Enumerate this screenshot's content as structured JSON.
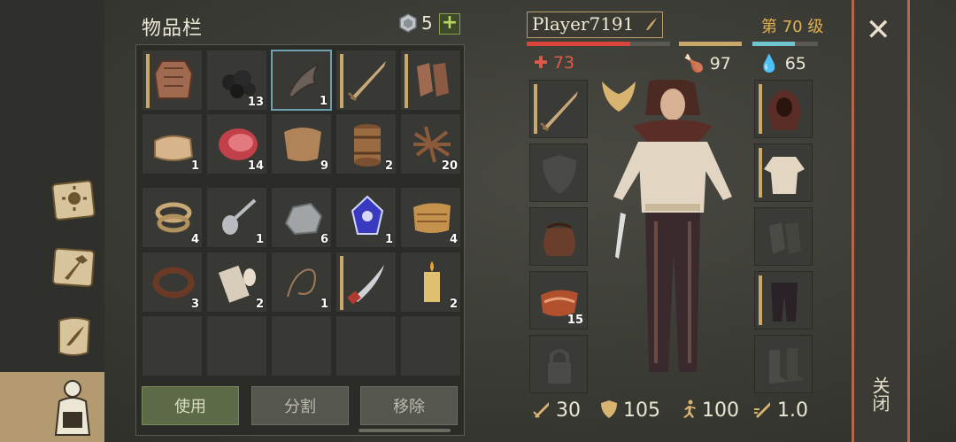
{
  "inventory": {
    "title": "物品栏",
    "currency_count": "5",
    "add_label": "+",
    "slots": [
      {
        "item": "gambeson",
        "count": ""
      },
      {
        "item": "coal",
        "count": "13"
      },
      {
        "item": "dark-bow",
        "count": "1",
        "selected": true
      },
      {
        "item": "sword",
        "count": ""
      },
      {
        "item": "gloves",
        "count": ""
      },
      {
        "item": "cloth",
        "count": "1"
      },
      {
        "item": "raw-meat",
        "count": "14"
      },
      {
        "item": "leather",
        "count": "9"
      },
      {
        "item": "barrel",
        "count": "2"
      },
      {
        "item": "sticks",
        "count": "20"
      },
      {
        "item": "rope",
        "count": "4"
      },
      {
        "item": "spoon",
        "count": "1"
      },
      {
        "item": "stone",
        "count": "6"
      },
      {
        "item": "crystal",
        "count": "1"
      },
      {
        "item": "straw",
        "count": "4"
      },
      {
        "item": "leather-strap",
        "count": "3"
      },
      {
        "item": "fabric-roll",
        "count": "2"
      },
      {
        "item": "string",
        "count": "1"
      },
      {
        "item": "saber",
        "count": ""
      },
      {
        "item": "candle",
        "count": "2"
      }
    ],
    "buttons": {
      "use": "使用",
      "split": "分割",
      "remove": "移除"
    }
  },
  "player": {
    "name": "Player7191",
    "level": "第 70 级",
    "health": "73",
    "food": "97",
    "water": "65",
    "health_fraction": 0.72,
    "food_fraction": 1.0,
    "water_fraction": 0.65,
    "equip_left": [
      {
        "item": "sword",
        "count": ""
      },
      {
        "item": "shield-empty",
        "count": ""
      },
      {
        "item": "pouch",
        "count": ""
      },
      {
        "item": "bacon",
        "count": "15"
      },
      {
        "item": "lock",
        "count": ""
      }
    ],
    "equip_right": [
      {
        "item": "hood",
        "count": ""
      },
      {
        "item": "shirt",
        "count": ""
      },
      {
        "item": "gloves-empty",
        "count": ""
      },
      {
        "item": "pants",
        "count": ""
      },
      {
        "item": "boots-empty",
        "count": ""
      }
    ],
    "stats": {
      "attack": "30",
      "armor": "105",
      "speed": "100",
      "attack_speed": "1.0"
    }
  },
  "close": {
    "x": "✕",
    "label": "关闭"
  },
  "colors": {
    "health": "#d9453a",
    "food": "#c9a86a",
    "water": "#6fc4d0",
    "accent": "#e0b050"
  }
}
